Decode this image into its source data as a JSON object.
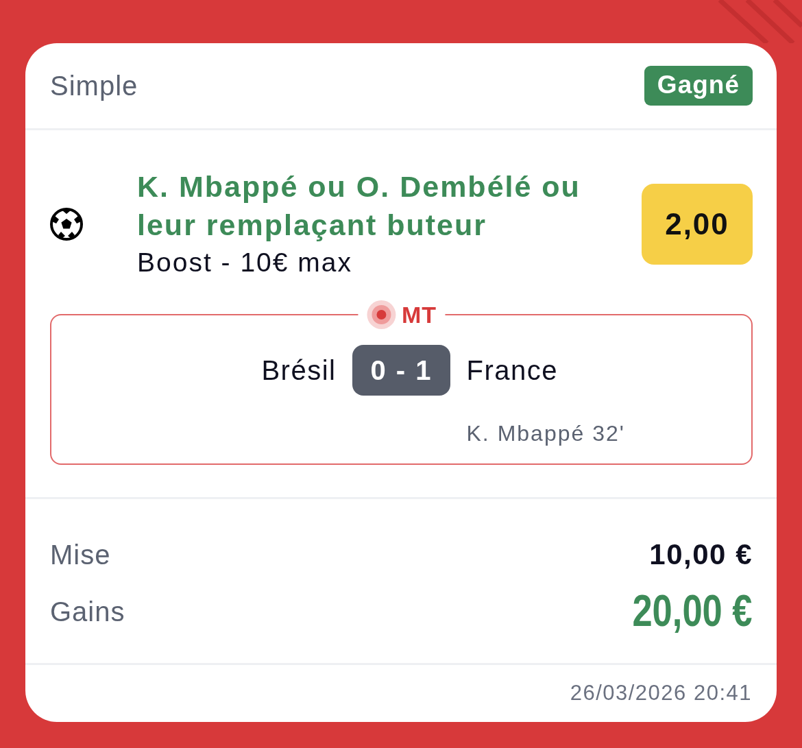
{
  "header": {
    "bet_type": "Simple",
    "status": {
      "label": "Gagné",
      "kind": "won"
    }
  },
  "selection": {
    "title": "K. Mbappé ou O. Dembélé ou leur remplaçant buteur",
    "subtitle": "Boost - 10€ max",
    "odds": "2,00"
  },
  "match": {
    "live": true,
    "period": "MT",
    "home": "Brésil",
    "score": "0 - 1",
    "away": "France",
    "scorers": [
      "K. Mbappé 32'"
    ]
  },
  "summary": [
    {
      "label": "Mise",
      "value": "10,00 €",
      "kind": "stake"
    },
    {
      "label": "Gains",
      "value": "20,00 €",
      "kind": "winnings"
    }
  ],
  "footer": {
    "placed_at": "26/03/2026 20:41"
  }
}
